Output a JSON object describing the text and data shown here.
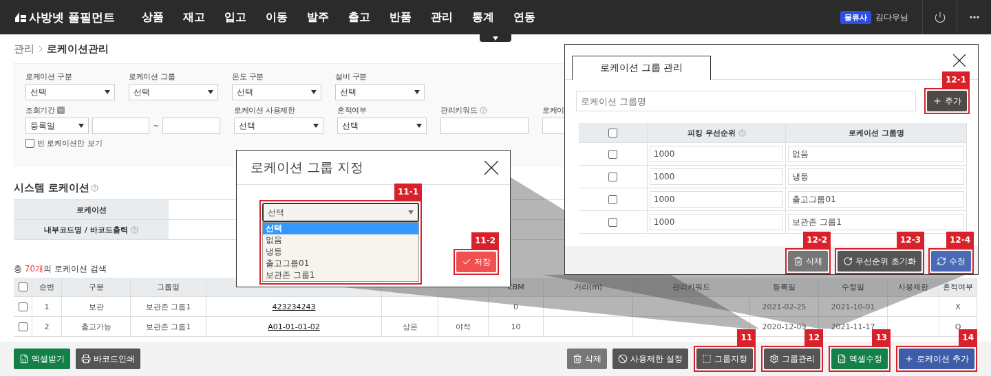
{
  "nav": {
    "logo": "사방넷 풀필먼트",
    "menu": [
      "상품",
      "재고",
      "입고",
      "이동",
      "발주",
      "출고",
      "반품",
      "관리",
      "통계",
      "연동"
    ],
    "user_badge": "물류사",
    "user_name": "김다우님"
  },
  "breadcrumb": {
    "parent": "관리",
    "current": "로케이션관리"
  },
  "filters": {
    "classification": [
      {
        "kind": "select",
        "label": "로케이션 구분",
        "value": "선택"
      },
      {
        "kind": "select",
        "label": "로케이션 그룹",
        "value": "선택"
      },
      {
        "kind": "select",
        "label": "온도 구분",
        "value": "선택"
      },
      {
        "kind": "select",
        "label": "설비 구분",
        "value": "선택"
      }
    ],
    "conditions": [
      {
        "kind": "date_range",
        "label": "조회기간",
        "dropdown": true,
        "value": "등록일",
        "separator": "~"
      },
      {
        "kind": "select",
        "label": "로케이션 사용제한",
        "value": "선택"
      },
      {
        "kind": "select",
        "label": "혼적여부",
        "value": "선택"
      },
      {
        "kind": "input",
        "label": "관리키워드",
        "help": true
      },
      {
        "kind": "input",
        "label": "로케이"
      }
    ],
    "empty_only": {
      "label": "빈 로케이션만 보기",
      "checked": false
    }
  },
  "system_locations": {
    "title": "시스템 로케이션",
    "rows": [
      {
        "label": "로케이션",
        "help": false
      },
      {
        "label": "내부코드명 / 바코드출력",
        "help": true
      }
    ]
  },
  "results": {
    "prefix": "총 ",
    "count": "70개",
    "suffix": "의 로케이션 검색"
  },
  "table": {
    "all_checked": false,
    "columns": [
      {
        "label": "순번"
      },
      {
        "label": "구분"
      },
      {
        "label": "그룹명"
      },
      {
        "kind": "link"
      },
      {
        "kind": "text"
      },
      {
        "kind": "text"
      },
      {
        "label": "CBM"
      },
      {
        "label": "거리(m)"
      },
      {
        "label": "관리키워드"
      },
      {
        "label": "등록일"
      },
      {
        "label": "수정일"
      },
      {
        "label": "사용제한"
      },
      {
        "label": "혼적여부"
      }
    ],
    "rows": [
      {
        "checked": false,
        "cells": [
          "1",
          "보관",
          "보관존 그룹1",
          "423234243",
          "",
          "",
          "0",
          "",
          "",
          "2021-02-25",
          "2021-10-01",
          "",
          "X"
        ]
      },
      {
        "checked": false,
        "cells": [
          "2",
          "출고가능",
          "보관존 그룹1",
          "A01-01-01-02",
          "상온",
          "야적",
          "10",
          "",
          "",
          "2020-12-09",
          "2021-11-17",
          "",
          "O"
        ]
      }
    ]
  },
  "bottom_bar": {
    "left": [
      {
        "kind": "excel",
        "label": "엑셀받기"
      },
      {
        "kind": "print",
        "label": "바코드인쇄"
      }
    ],
    "right": [
      {
        "kind": "delete",
        "label": "삭제"
      },
      {
        "kind": "restrict",
        "label": "사용제한 설정"
      },
      {
        "kind": "assign",
        "label": "그룹지정",
        "callout": "11"
      },
      {
        "kind": "manage",
        "label": "그룹관리",
        "callout": "12"
      },
      {
        "kind": "excel",
        "label": "엑셀수정",
        "callout": "13"
      },
      {
        "kind": "add",
        "label": "로케이션 추가",
        "callout": "14"
      }
    ]
  },
  "assign_dialog": {
    "title": "로케이션 그룹 지정",
    "select": {
      "value": "선택",
      "callout": "11-1",
      "options": [
        {
          "label": "선택",
          "selected": true
        },
        {
          "label": "없음",
          "selected": false
        },
        {
          "label": "냉동",
          "selected": false
        },
        {
          "label": "출고그룹01",
          "selected": false
        },
        {
          "label": "보관존 그룹1",
          "selected": false
        }
      ]
    },
    "save": {
      "label": "저장",
      "callout": "11-2"
    }
  },
  "manage_dialog": {
    "tab": "로케이션 그룹 관리",
    "name_field": {
      "placeholder": "로케이션 그룹명"
    },
    "add": {
      "label": "추가",
      "callout": "12-1"
    },
    "all_checked": false,
    "columns": [
      "피킹 우선순위",
      "로케이션 그룹명"
    ],
    "rows": [
      {
        "checked": false,
        "priority": "1000",
        "name": "없음"
      },
      {
        "checked": false,
        "priority": "1000",
        "name": "냉동"
      },
      {
        "checked": false,
        "priority": "1000",
        "name": "출고그룹01"
      },
      {
        "checked": false,
        "priority": "1000",
        "name": "보관존 그룹1"
      }
    ],
    "buttons": [
      {
        "kind": "delete",
        "label": "삭제",
        "callout": "12-2"
      },
      {
        "kind": "reset",
        "label": "우선순위 초기화",
        "callout": "12-3"
      },
      {
        "kind": "edit",
        "label": "수정",
        "callout": "12-4"
      }
    ]
  }
}
